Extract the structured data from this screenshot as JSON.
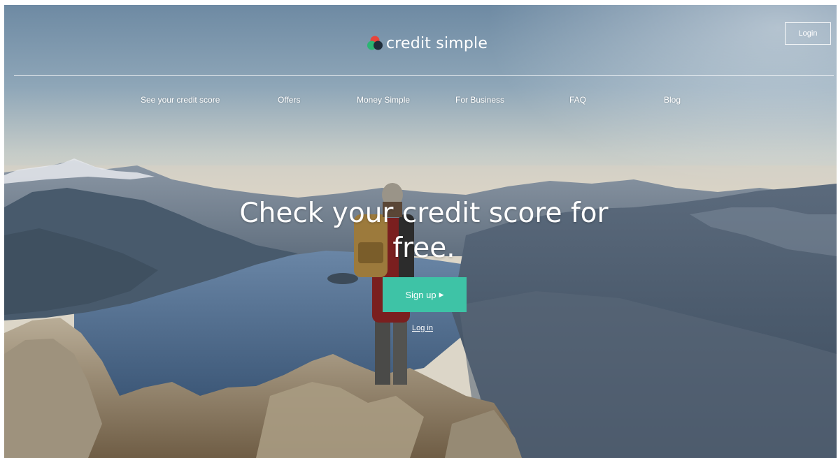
{
  "header": {
    "logo_text": "credit simple",
    "logo_icon": "overlapping-circles-logo",
    "login_label": "Login"
  },
  "nav": {
    "items": [
      {
        "label": "See your credit score"
      },
      {
        "label": "Offers"
      },
      {
        "label": "Money Simple"
      },
      {
        "label": "For Business"
      },
      {
        "label": "FAQ"
      },
      {
        "label": "Blog"
      }
    ]
  },
  "hero": {
    "headline_line1": "Check your credit score for",
    "headline_line2": "free.",
    "signup_label": "Sign up",
    "signup_icon": "play-arrow-icon",
    "login_link": "Log in"
  },
  "colors": {
    "accent": "#3ec3a6",
    "logo_red": "#e8443a",
    "logo_green": "#2bb573",
    "logo_dark": "#1f2d3a"
  }
}
